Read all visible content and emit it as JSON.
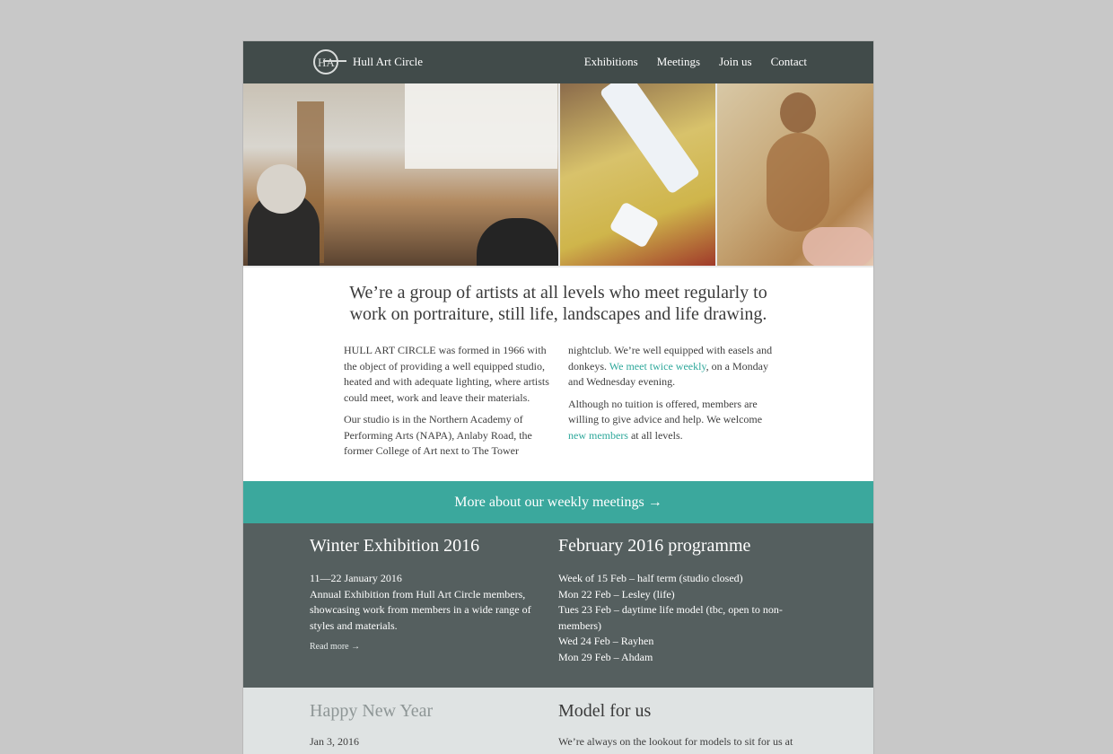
{
  "header": {
    "site_title": "Hull Art Circle",
    "logo_icon": "hac-monogram-logo",
    "nav": [
      "Exhibitions",
      "Meetings",
      "Join us",
      "Contact"
    ]
  },
  "hero": {
    "photos": [
      "studio-easel-photo",
      "paint-tube-photo",
      "figure-painting-photo"
    ]
  },
  "intro": {
    "heading_line1": "We’re a group of artists at all levels who meet regularly to",
    "heading_line2": "work on portraiture, still life, landscapes and life drawing.",
    "p1": "HULL ART CIRCLE was formed in 1966 with the object of providing a well equipped studio, heated and with adequate lighting, where artists could meet, work and leave their materials.",
    "p2": "Our studio is in the Northern Academy of Performing Arts (NAPA), Anlaby Road, the former College of Art next to The Tower",
    "p3_before": "nightclub. We’re well equipped with easels and donkeys. ",
    "p3_link": "We meet twice weekly",
    "p3_after": ", on a Monday and Wednesday evening.",
    "p4_before": "Although no tuition is offered, members are willing to give advice and help. We welcome ",
    "p4_link": "new members",
    "p4_after": " at all levels."
  },
  "band": {
    "label": "More about our weekly meetings →"
  },
  "exhibition": {
    "title": "Winter Exhibition 2016",
    "dates": "11—22 January 2016",
    "description": "Annual Exhibition from Hull Art Circle members, showcasing work from members in a wide range of styles and materials.",
    "read_more": "Read more →"
  },
  "programme": {
    "title": "February 2016 programme",
    "items": [
      "Week of 15 Feb – half term (studio closed)",
      "Mon 22 Feb – Lesley (life)",
      "Tues 23 Feb – daytime life model (tbc, open to non-members)",
      "Wed 24 Feb – Rayhen",
      "Mon 29 Feb – Ahdam"
    ]
  },
  "news": {
    "title": "Happy New Year",
    "date": "Jan 3, 2016"
  },
  "model": {
    "title": "Model for us",
    "text": "We’re always on the lookout for models to sit for us at"
  },
  "colors": {
    "header_bg": "#414b4a",
    "accent": "#3ba89d",
    "dark_section": "#555f5f",
    "light_section": "#dfe3e3"
  }
}
